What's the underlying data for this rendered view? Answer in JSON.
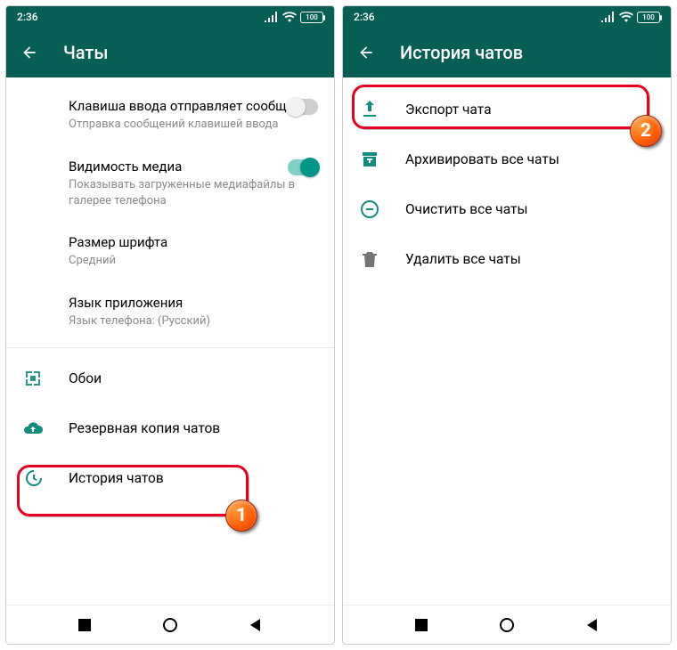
{
  "colors": {
    "brand": "#075e54",
    "accent": "#128c7e",
    "teal": "#009688",
    "callout": "#e6001f"
  },
  "status": {
    "time": "2:36",
    "battery": "100"
  },
  "left": {
    "title": "Чаты",
    "settings": [
      {
        "title": "Клавиша ввода отправляет сообщение",
        "sub": "Отправка сообщений клавишей ввода",
        "toggle": "off"
      },
      {
        "title": "Видимость медиа",
        "sub": "Показывать загруженные медиафайлы в галерее телефона",
        "toggle": "on"
      },
      {
        "title": "Размер шрифта",
        "sub": "Средний"
      },
      {
        "title": "Язык приложения",
        "sub": "Язык телефона: (Русский)"
      }
    ],
    "iconItems": [
      {
        "icon": "wallpaper",
        "label": "Обои"
      },
      {
        "icon": "cloud-up",
        "label": "Резервная копия чатов"
      },
      {
        "icon": "history",
        "label": "История чатов"
      }
    ],
    "calloutBadge": "1"
  },
  "right": {
    "title": "История чатов",
    "items": [
      {
        "icon": "export",
        "label": "Экспорт чата",
        "color": "teal"
      },
      {
        "icon": "archive",
        "label": "Архивировать все чаты",
        "color": "teal"
      },
      {
        "icon": "clear-circle",
        "label": "Очистить все чаты",
        "color": "teal"
      },
      {
        "icon": "trash",
        "label": "Удалить все чаты",
        "color": "gray"
      }
    ],
    "calloutBadge": "2"
  }
}
